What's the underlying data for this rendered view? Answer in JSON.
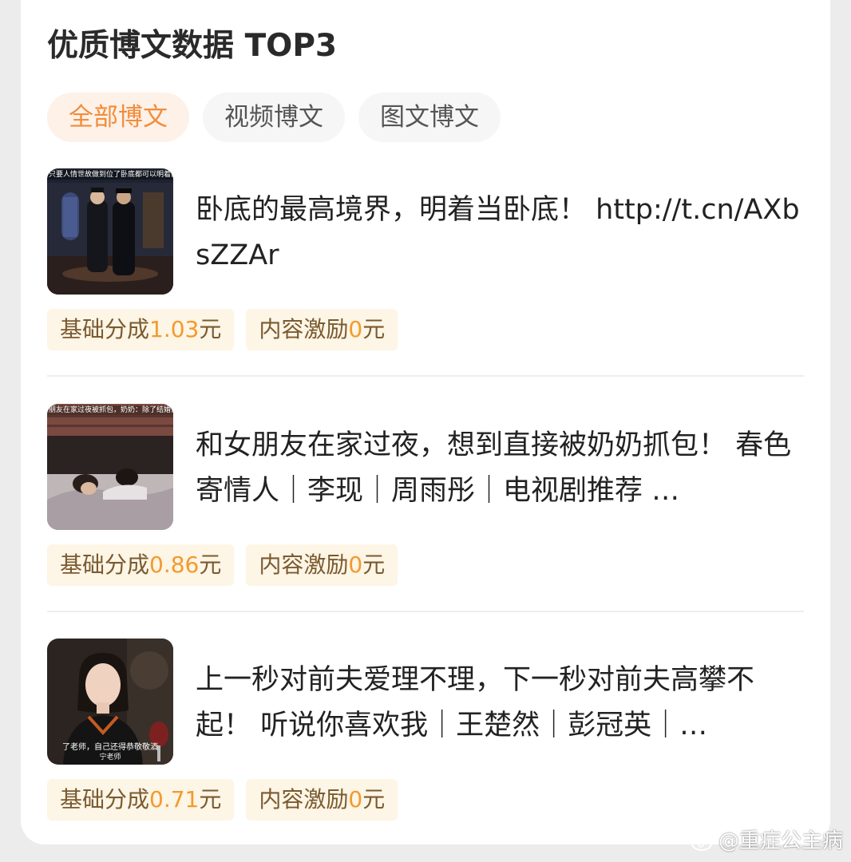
{
  "header": {
    "title": "优质博文数据 TOP3"
  },
  "tabs": [
    {
      "label": "全部博文"
    },
    {
      "label": "视频博文"
    },
    {
      "label": "图文博文"
    }
  ],
  "posts": [
    {
      "thumb_caption": "只要人情世故做到位了卧底都可以明着卧了",
      "text": "卧底的最高境界，明着当卧底！ http://t.cn/AXbsZZAr",
      "base_label": "基础分成",
      "base_value": "1.03",
      "base_unit": "元",
      "incentive_label": "内容激励",
      "incentive_value": "0",
      "incentive_unit": "元"
    },
    {
      "thumb_caption": "朋友在家过夜被抓包，奶奶：除了结婚没其他办",
      "text": "和女朋友在家过夜，想到直接被奶奶抓包！ 春色寄情人｜李现｜周雨彤｜电视剧推荐 …",
      "base_label": "基础分成",
      "base_value": "0.86",
      "base_unit": "元",
      "incentive_label": "内容激励",
      "incentive_value": "0",
      "incentive_unit": "元"
    },
    {
      "thumb_caption": "",
      "thumb_subtitle": "了老师，自己还得恭敬敬酒",
      "thumb_subtitle2": "宁老师",
      "text": "上一秒对前夫爱理不理，下一秒对前夫高攀不起！ 听说你喜欢我｜王楚然｜彭冠英｜…",
      "base_label": "基础分成",
      "base_value": "0.71",
      "base_unit": "元",
      "incentive_label": "内容激励",
      "incentive_value": "0",
      "incentive_unit": "元"
    }
  ],
  "watermark": {
    "text": "@重症公主病"
  }
}
